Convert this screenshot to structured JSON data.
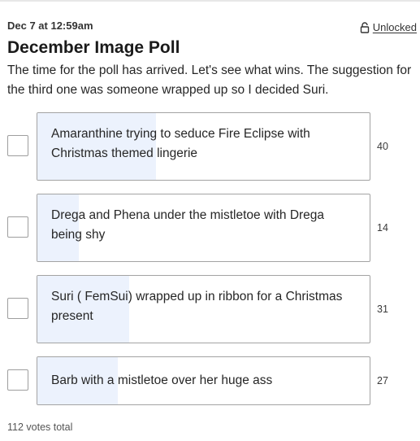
{
  "post": {
    "date": "Dec 7 at 12:59am",
    "status_label": "Unlocked",
    "title": "December Image Poll",
    "description": "The time for the poll has arrived. Let's see what wins. The suggestion for the third one was someone wrapped up so I decided Suri."
  },
  "poll": {
    "options": [
      {
        "label": "Amaranthine trying to seduce Fire Eclipse with Christmas themed lingerie",
        "votes": "40",
        "share": 0.357
      },
      {
        "label": "Drega and Phena under the mistletoe with Drega being shy",
        "votes": "14",
        "share": 0.125
      },
      {
        "label": "Suri ( FemSui) wrapped up in ribbon for a Christmas present",
        "votes": "31",
        "share": 0.277
      },
      {
        "label": "Barb with a mistletoe over her huge ass",
        "votes": "27",
        "share": 0.241
      }
    ],
    "total_label": "112 votes total"
  },
  "colors": {
    "fill": "#ecf2fd",
    "border": "#a3a3a3"
  },
  "icons": {
    "status": "unlock-icon"
  }
}
